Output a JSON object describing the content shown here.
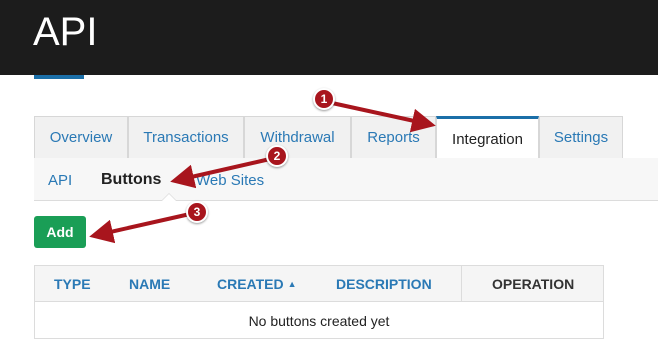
{
  "colors": {
    "topbar": "#1c1c1c",
    "accent": "#1b6fa8",
    "link": "#2a79b5",
    "text_dark": "#222222",
    "add_button": "#1a9e56",
    "annotation": "#a8151d"
  },
  "header": {
    "title": "API"
  },
  "tabs": [
    {
      "label": "Overview"
    },
    {
      "label": "Transactions"
    },
    {
      "label": "Withdrawal"
    },
    {
      "label": "Reports"
    },
    {
      "label": "Integration"
    },
    {
      "label": "Settings"
    }
  ],
  "active_tab": "Integration",
  "subnav": {
    "items": [
      {
        "label": "API"
      },
      {
        "label": "Buttons"
      },
      {
        "label": "Web Sites"
      }
    ],
    "active": "Buttons"
  },
  "toolbar": {
    "add_label": "Add"
  },
  "table": {
    "columns": [
      "TYPE",
      "NAME",
      "CREATED",
      "DESCRIPTION",
      "OPERATION"
    ],
    "sorted_column": "CREATED",
    "sort_icon": "caret-up-icon",
    "empty_message": "No buttons created yet"
  },
  "annotations": [
    {
      "number": "1",
      "icon": "arrow-icon"
    },
    {
      "number": "2",
      "icon": "arrow-icon"
    },
    {
      "number": "3",
      "icon": "arrow-icon"
    }
  ]
}
